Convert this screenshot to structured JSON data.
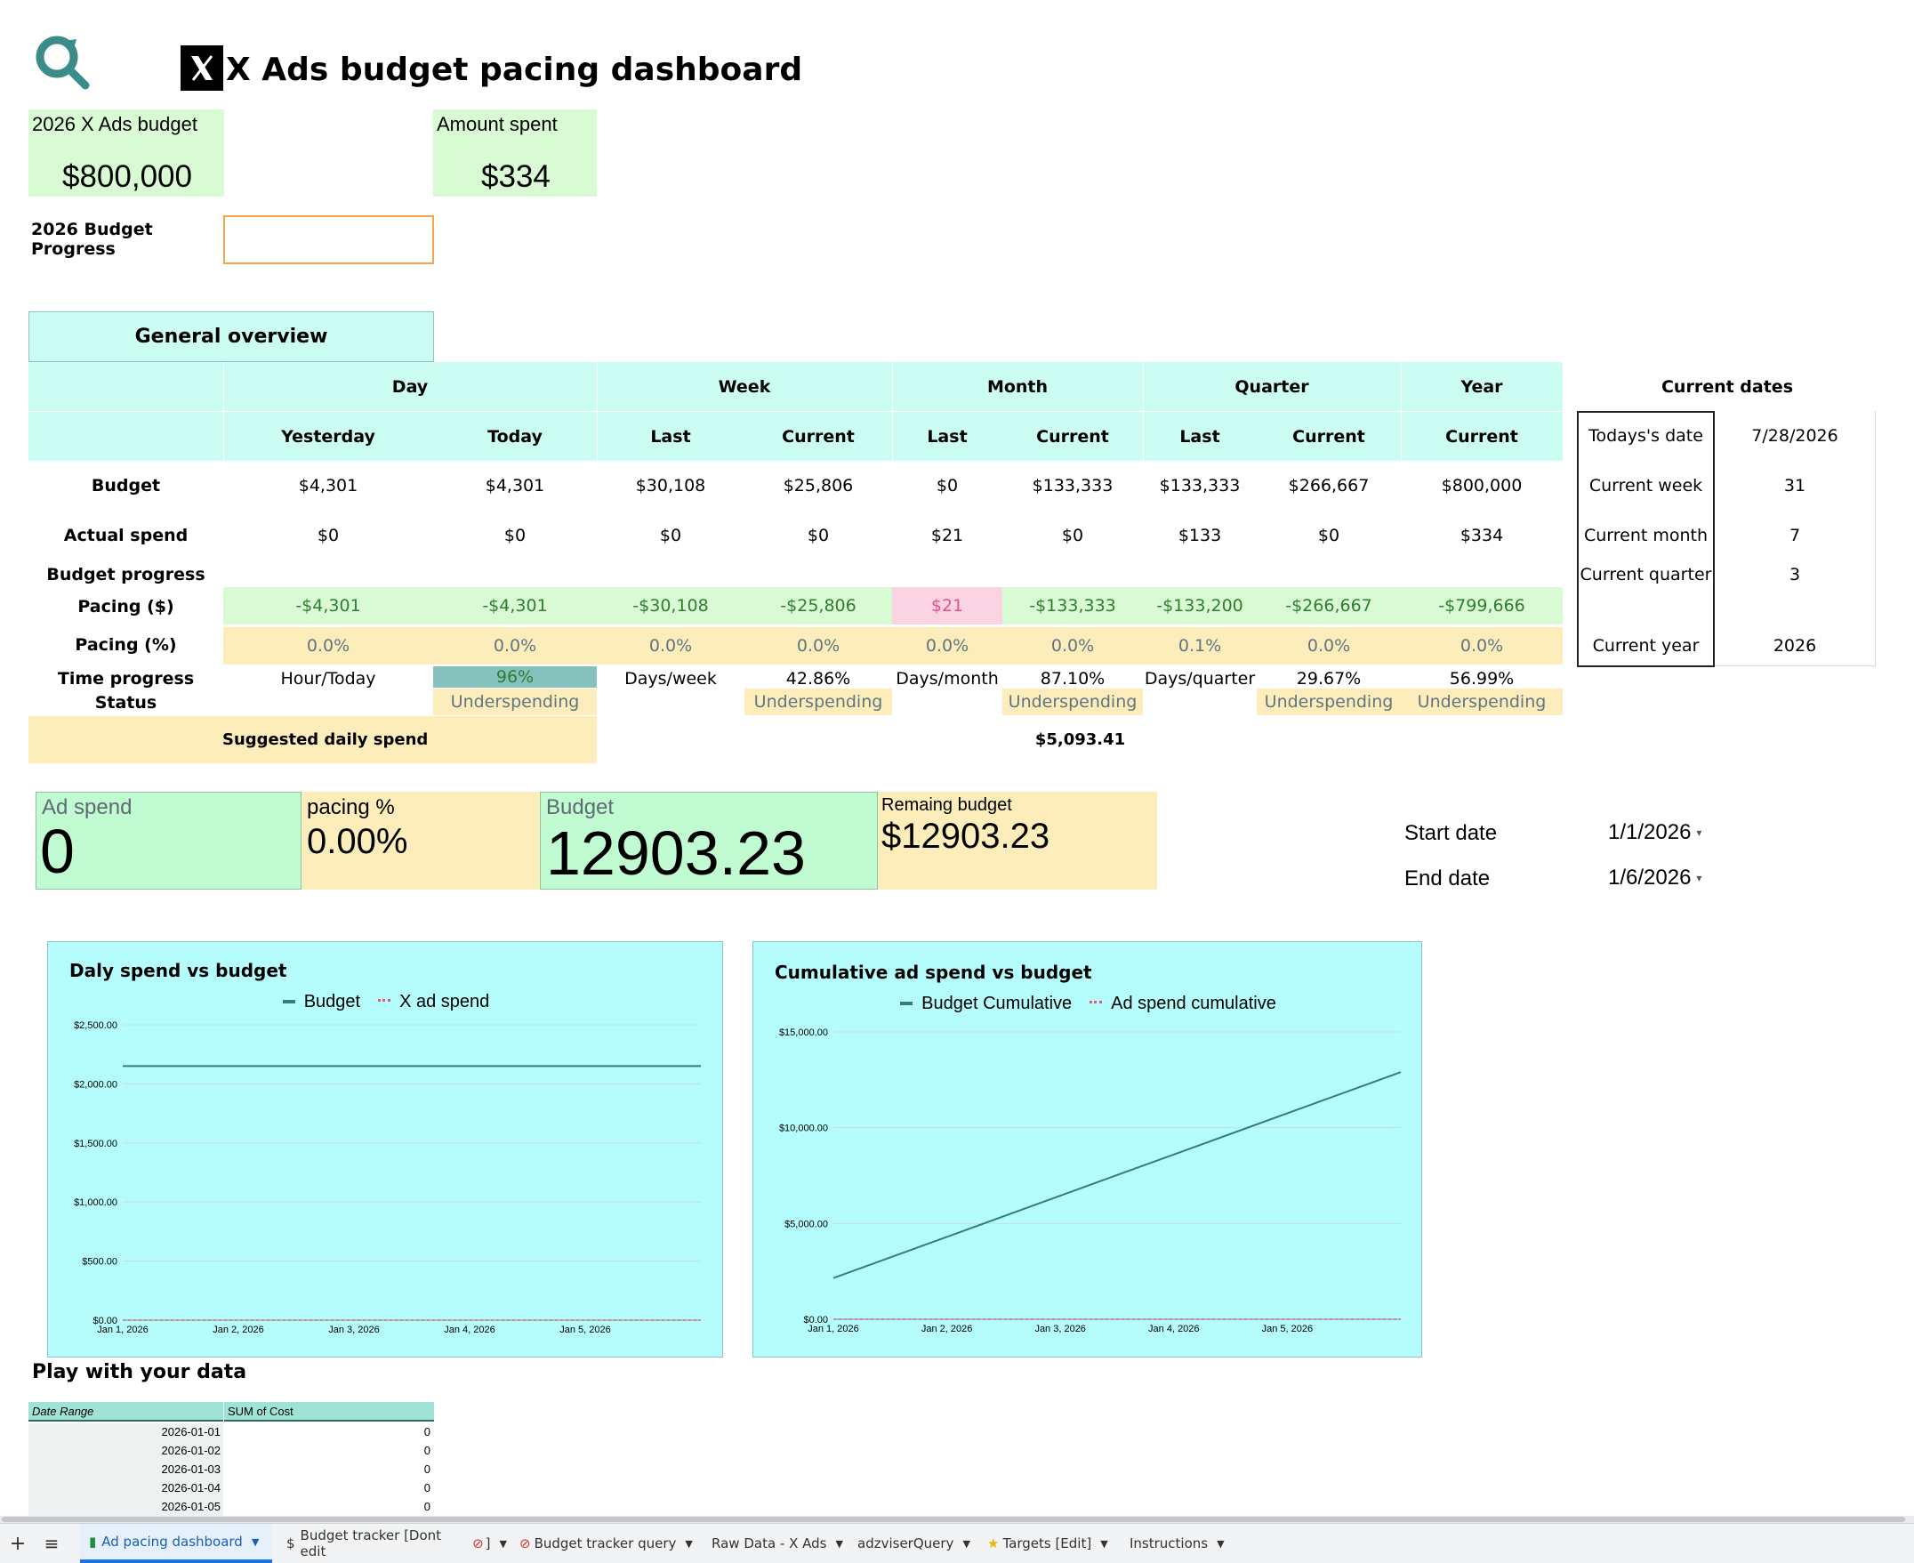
{
  "title": "X Ads budget pacing dashboard",
  "kpis": {
    "budget_label": "2026 X Ads budget",
    "budget_value": "$800,000",
    "spent_label": "Amount spent",
    "spent_value": "$334",
    "progress_label": "2026  Budget Progress"
  },
  "overview": {
    "title": "General overview",
    "groups": [
      "Day",
      "Week",
      "Month",
      "Quarter",
      "Year"
    ],
    "subheaders": [
      "Yesterday",
      "Today",
      "Last",
      "Current",
      "Last",
      "Current",
      "Last",
      "Current",
      "Current"
    ],
    "rows": {
      "budget": {
        "label": "Budget",
        "values": [
          "$4,301",
          "$4,301",
          "$30,108",
          "$25,806",
          "$0",
          "$133,333",
          "$133,333",
          "$266,667",
          "$800,000"
        ]
      },
      "actual": {
        "label": "Actual spend",
        "values": [
          "$0",
          "$0",
          "$0",
          "$0",
          "$21",
          "$0",
          "$133",
          "$0",
          "$334"
        ]
      },
      "progress": {
        "label": "Budget progress"
      },
      "pacing_usd": {
        "label": "Pacing ($)",
        "values": [
          "-$4,301",
          "-$4,301",
          "-$30,108",
          "-$25,806",
          "$21",
          "-$133,333",
          "-$133,200",
          "-$266,667",
          "-$799,666"
        ]
      },
      "pacing_pct": {
        "label": "Pacing  (%)",
        "values": [
          "0.0%",
          "0.0%",
          "0.0%",
          "0.0%",
          "0.0%",
          "0.0%",
          "0.1%",
          "0.0%",
          "0.0%"
        ]
      },
      "time_progress": {
        "label": "Time progress",
        "values": [
          "Hour/Today",
          "96%",
          "Days/week",
          "42.86%",
          "Days/month",
          "87.10%",
          "Days/quarter",
          "29.67%",
          "56.99%"
        ]
      },
      "status": {
        "label": "Status",
        "values": [
          "Underspending",
          "Underspending",
          "Underspending",
          "Underspending",
          "Underspending"
        ]
      }
    },
    "suggested_label": "Suggested daily spend",
    "suggested_value": "$5,093.41"
  },
  "current_dates": {
    "title": "Current dates",
    "rows": [
      {
        "label": "Todays's date",
        "value": "7/28/2026"
      },
      {
        "label": "Current week",
        "value": "31"
      },
      {
        "label": "Current month",
        "value": "7"
      },
      {
        "label": "Current quarter",
        "value": "3"
      },
      {
        "label": "Current year",
        "value": "2026"
      }
    ]
  },
  "scorecards": {
    "ad_spend_label": "Ad spend",
    "ad_spend_value": "0",
    "pacing_label": "pacing %",
    "pacing_value": "0.00%",
    "budget_label": "Budget",
    "budget_value": "12903.23",
    "remaining_label": "Remaing budget",
    "remaining_value": "$12903.23"
  },
  "date_range": {
    "start_label": "Start date",
    "start_value": "1/1/2026",
    "end_label": "End date",
    "end_value": "1/6/2026"
  },
  "chart_data": [
    {
      "type": "line",
      "title": "Daly spend vs budget",
      "x": [
        "Jan 1, 2026",
        "Jan 2, 2026",
        "Jan 3, 2026",
        "Jan 4, 2026",
        "Jan 5, 2026",
        "Jan 6, 2026"
      ],
      "x_tick_labels": [
        "Jan 1, 2026",
        "Jan 2, 2026",
        "Jan 3, 2026",
        "Jan 4, 2026",
        "Jan 5, 2026"
      ],
      "y_ticks": [
        "$0.00",
        "$500.00",
        "$1,000.00",
        "$1,500.00",
        "$2,000.00",
        "$2,500.00"
      ],
      "ylim": [
        0,
        2500
      ],
      "legend": "top",
      "grid": true,
      "series": [
        {
          "name": "Budget",
          "values": [
            2150.54,
            2150.54,
            2150.54,
            2150.54,
            2150.54,
            2150.54
          ],
          "color": "#2f7f7d",
          "dash": false
        },
        {
          "name": "X ad spend",
          "values": [
            0,
            0,
            0,
            0,
            0,
            0
          ],
          "color": "#e65a7a",
          "dash": true
        }
      ]
    },
    {
      "type": "line",
      "title": "Cumulative ad spend vs budget",
      "x": [
        "Jan 1, 2026",
        "Jan 2, 2026",
        "Jan 3, 2026",
        "Jan 4, 2026",
        "Jan 5, 2026",
        "Jan 6, 2026"
      ],
      "x_tick_labels": [
        "Jan 1, 2026",
        "Jan 2, 2026",
        "Jan 3, 2026",
        "Jan 4, 2026",
        "Jan 5, 2026"
      ],
      "y_ticks": [
        "$0.00",
        "$5,000.00",
        "$10,000.00",
        "$15,000.00"
      ],
      "ylim": [
        0,
        15000
      ],
      "legend": "top",
      "grid": true,
      "series": [
        {
          "name": "Budget Cumulative",
          "values": [
            2150.54,
            4301.08,
            6451.61,
            8602.15,
            10752.69,
            12903.23
          ],
          "color": "#2f7f7d",
          "dash": false
        },
        {
          "name": "Ad spend cumulative",
          "values": [
            0,
            0,
            0,
            0,
            0,
            0
          ],
          "color": "#e65a7a",
          "dash": true
        }
      ]
    }
  ],
  "play": {
    "title": "Play with your data",
    "col1": "Date Range",
    "col2": "SUM of Cost",
    "rows": [
      {
        "date": "2026-01-01",
        "cost": "0"
      },
      {
        "date": "2026-01-02",
        "cost": "0"
      },
      {
        "date": "2026-01-03",
        "cost": "0"
      },
      {
        "date": "2026-01-04",
        "cost": "0"
      },
      {
        "date": "2026-01-05",
        "cost": "0"
      }
    ]
  },
  "tabs": [
    "Ad pacing dashboard",
    "Budget tracker [Dont edit",
    "Budget tracker query",
    "Raw Data - X Ads",
    "adzviserQuery",
    "Targets [Edit]",
    "Instructions"
  ],
  "colors": {
    "cyan": "#ccfdf3",
    "green": "#d9fbd3",
    "cream": "#fdedbb",
    "pink": "#fbd4e3",
    "chart_bg": "#b5fdfd",
    "teal": "#2f7f7d"
  }
}
